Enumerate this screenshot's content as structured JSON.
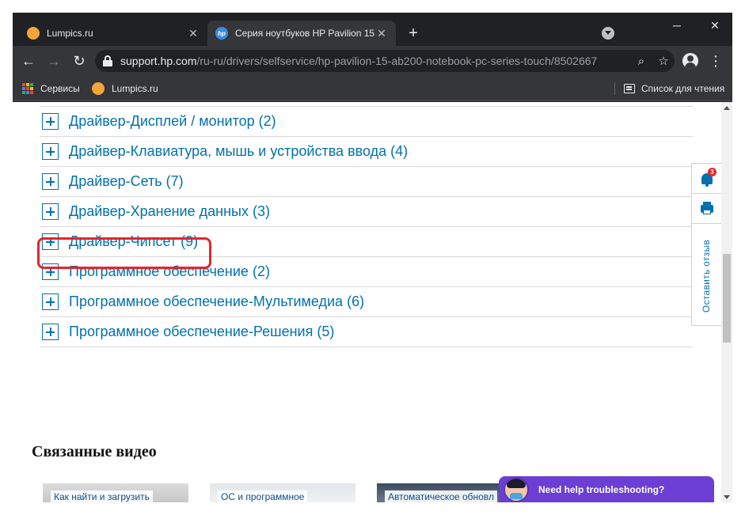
{
  "browser": {
    "tabs": [
      {
        "title": "Lumpics.ru",
        "active": false
      },
      {
        "title": "Серия ноутбуков HP Pavilion 15",
        "active": true
      }
    ],
    "new_tab_label": "+",
    "window_controls": {
      "minimize": "─",
      "maximize": "☐",
      "close": "✕"
    },
    "url": {
      "host": "support.hp.com",
      "path": "/ru-ru/drivers/selfservice/hp-pavilion-15-ab200-notebook-pc-series-touch/8502667"
    },
    "bookmarks": [
      {
        "label": "Сервисы",
        "icon": "apps-grid-icon"
      },
      {
        "label": "Lumpics.ru",
        "icon": "lumpics-favicon"
      }
    ],
    "reading_list_label": "Список для чтения"
  },
  "accordion": {
    "items": [
      {
        "label": "Драйвер-Дисплей / монитор (2)"
      },
      {
        "label": "Драйвер-Клавиатура, мышь и устройства ввода (4)"
      },
      {
        "label": "Драйвер-Сеть (7)"
      },
      {
        "label": "Драйвер-Хранение данных (3)"
      },
      {
        "label": "Драйвер-Чипсет (9)",
        "highlighted": true
      },
      {
        "label": "Программное обеспечение (2)"
      },
      {
        "label": "Программное обеспечение-Мультимедиа (6)"
      },
      {
        "label": "Программное обеспечение-Решения (5)"
      }
    ]
  },
  "related_videos": {
    "title": "Связанные видео",
    "items": [
      {
        "label": "Как найти и загрузить"
      },
      {
        "label": "ОС и программное"
      },
      {
        "label": "Автоматическое обновл"
      }
    ]
  },
  "side_rail": {
    "notification_count": "3",
    "feedback_label": "Оставить отзыв"
  },
  "chat": {
    "label": "Need help troubleshooting?"
  },
  "colors": {
    "link_blue": "#0171ad",
    "highlight_red": "#e3262b",
    "chat_purple": "#6b3fd4"
  }
}
